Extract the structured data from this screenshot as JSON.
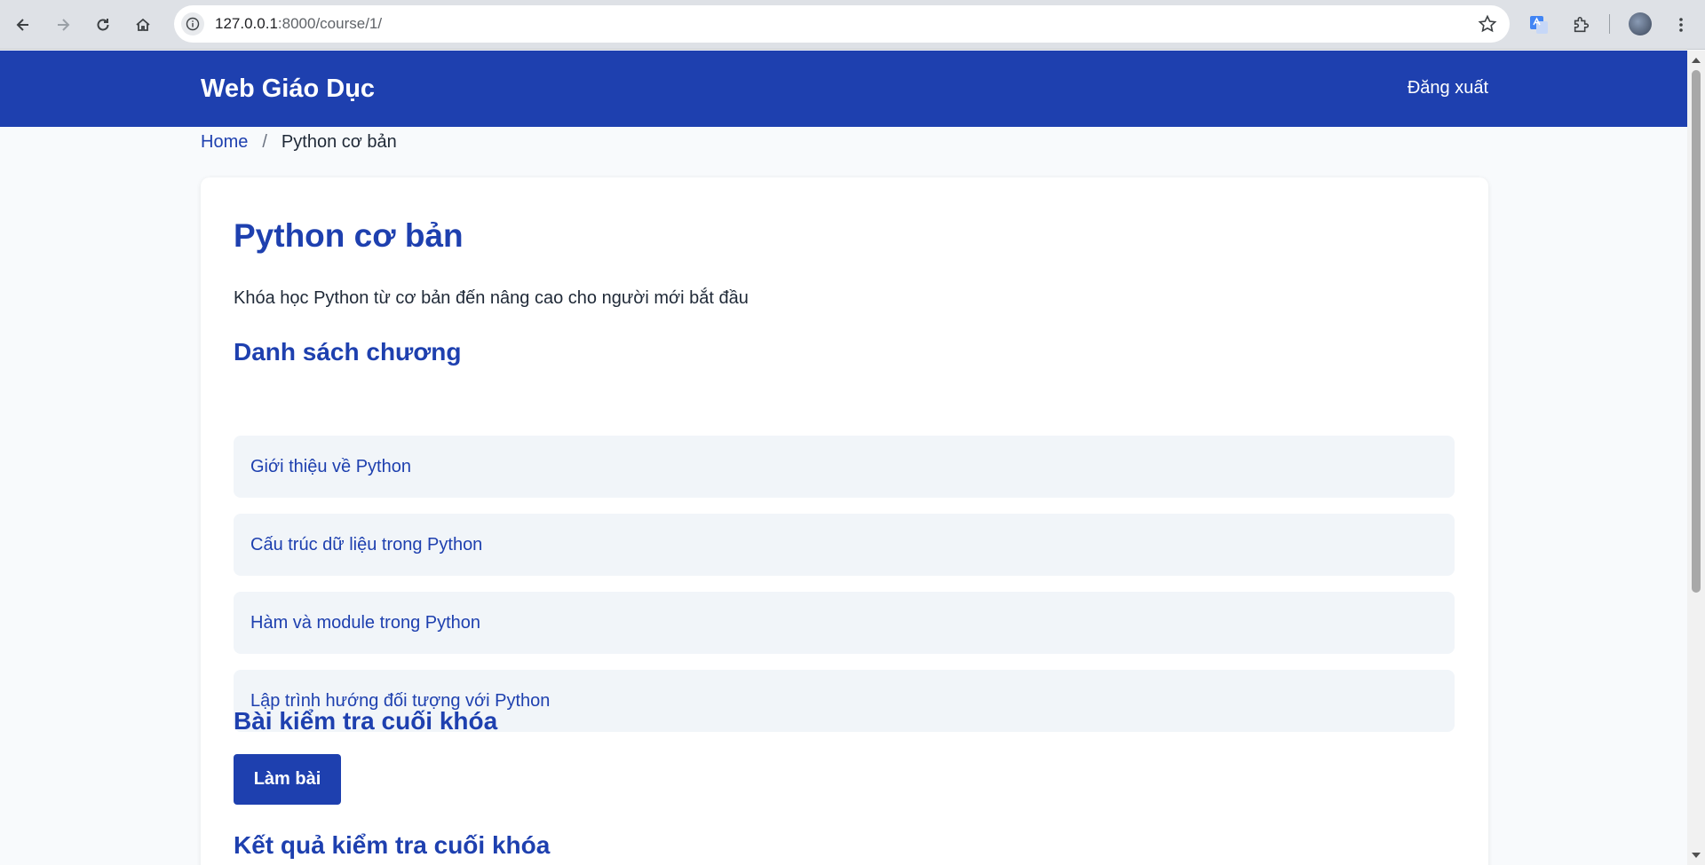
{
  "browser": {
    "url_host": "127.0.0.1",
    "url_rest": ":8000/course/1/"
  },
  "nav": {
    "brand": "Web Giáo Dục",
    "logout": "Đăng xuất"
  },
  "breadcrumb": {
    "home": "Home",
    "separator": "/",
    "current": "Python cơ bản"
  },
  "course": {
    "title": "Python cơ bản",
    "description": "Khóa học Python từ cơ bản đến nâng cao cho người mới bắt đầu"
  },
  "chapters": {
    "heading": "Danh sách chương",
    "items": [
      {
        "label": "Giới thiệu về Python"
      },
      {
        "label": "Cấu trúc dữ liệu trong Python"
      },
      {
        "label": "Hàm và module trong Python"
      },
      {
        "label": "Lập trình hướng đối tượng với Python"
      }
    ]
  },
  "final_quiz": {
    "heading": "Bài kiểm tra cuối khóa",
    "button": "Làm bài"
  },
  "results": {
    "heading": "Kết quả kiểm tra cuối khóa"
  },
  "colors": {
    "primary": "#1e40af",
    "chapter_bg": "#f1f5f9",
    "page_bg": "#f8fafc"
  }
}
